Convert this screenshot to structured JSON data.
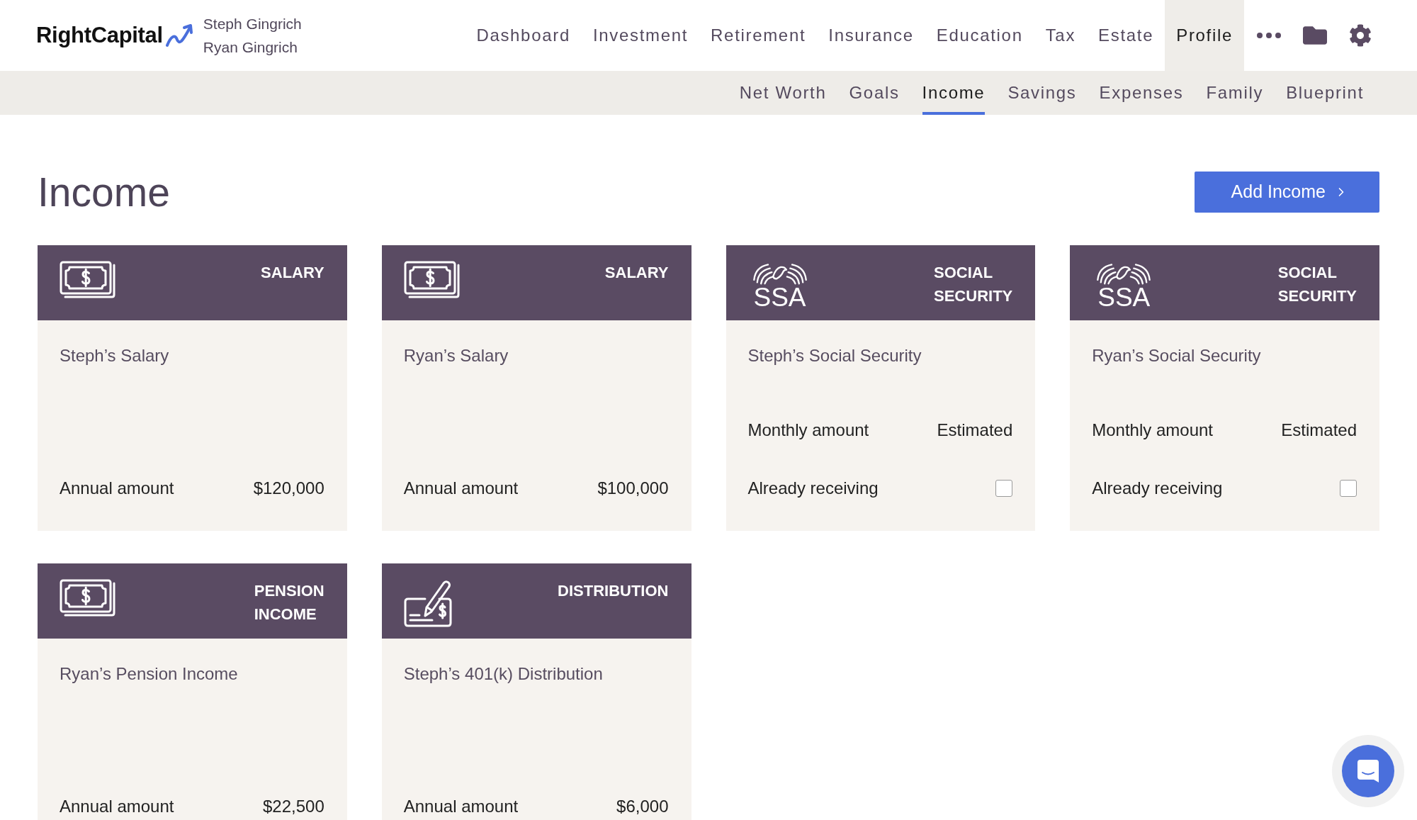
{
  "header": {
    "logo": "RightCapital",
    "clients": [
      "Steph Gingrich",
      "Ryan Gingrich"
    ],
    "nav": [
      {
        "label": "Dashboard",
        "selected": false
      },
      {
        "label": "Investment",
        "selected": false
      },
      {
        "label": "Retirement",
        "selected": false
      },
      {
        "label": "Insurance",
        "selected": false
      },
      {
        "label": "Education",
        "selected": false
      },
      {
        "label": "Tax",
        "selected": false
      },
      {
        "label": "Estate",
        "selected": false
      },
      {
        "label": "Profile",
        "selected": true
      }
    ]
  },
  "subnav": [
    {
      "label": "Net Worth",
      "selected": false
    },
    {
      "label": "Goals",
      "selected": false
    },
    {
      "label": "Income",
      "selected": true
    },
    {
      "label": "Savings",
      "selected": false
    },
    {
      "label": "Expenses",
      "selected": false
    },
    {
      "label": "Family",
      "selected": false
    },
    {
      "label": "Blueprint",
      "selected": false
    }
  ],
  "page": {
    "title": "Income",
    "add_button": "Add Income"
  },
  "cards": [
    {
      "kind": "salary",
      "category": "SALARY",
      "name": "Steph’s Salary",
      "rows": [
        {
          "kind": "amount",
          "label": "Annual amount",
          "value": "$120,000"
        }
      ]
    },
    {
      "kind": "salary",
      "category": "SALARY",
      "name": "Ryan’s Salary",
      "rows": [
        {
          "kind": "amount",
          "label": "Annual amount",
          "value": "$100,000"
        }
      ]
    },
    {
      "kind": "social_security",
      "logo": "SSA",
      "category": "SOCIAL SECURITY",
      "name": "Steph’s Social Security",
      "rows": [
        {
          "kind": "amount",
          "label": "Monthly amount",
          "value": "Estimated"
        },
        {
          "kind": "checkbox",
          "label": "Already receiving",
          "checked": false
        }
      ]
    },
    {
      "kind": "social_security",
      "logo": "SSA",
      "category": "SOCIAL SECURITY",
      "name": "Ryan’s Social Security",
      "rows": [
        {
          "kind": "amount",
          "label": "Monthly amount",
          "value": "Estimated"
        },
        {
          "kind": "checkbox",
          "label": "Already receiving",
          "checked": false
        }
      ]
    },
    {
      "kind": "pension",
      "category": "PENSION INCOME",
      "name": "Ryan’s Pension Income",
      "rows": [
        {
          "kind": "amount",
          "label": "Annual amount",
          "value": "$22,500"
        }
      ]
    },
    {
      "kind": "distribution",
      "category": "DISTRIBUTION",
      "name": "Steph’s 401(k) Distribution",
      "rows": [
        {
          "kind": "amount",
          "label": "Annual amount",
          "value": "$6,000"
        }
      ]
    }
  ]
}
